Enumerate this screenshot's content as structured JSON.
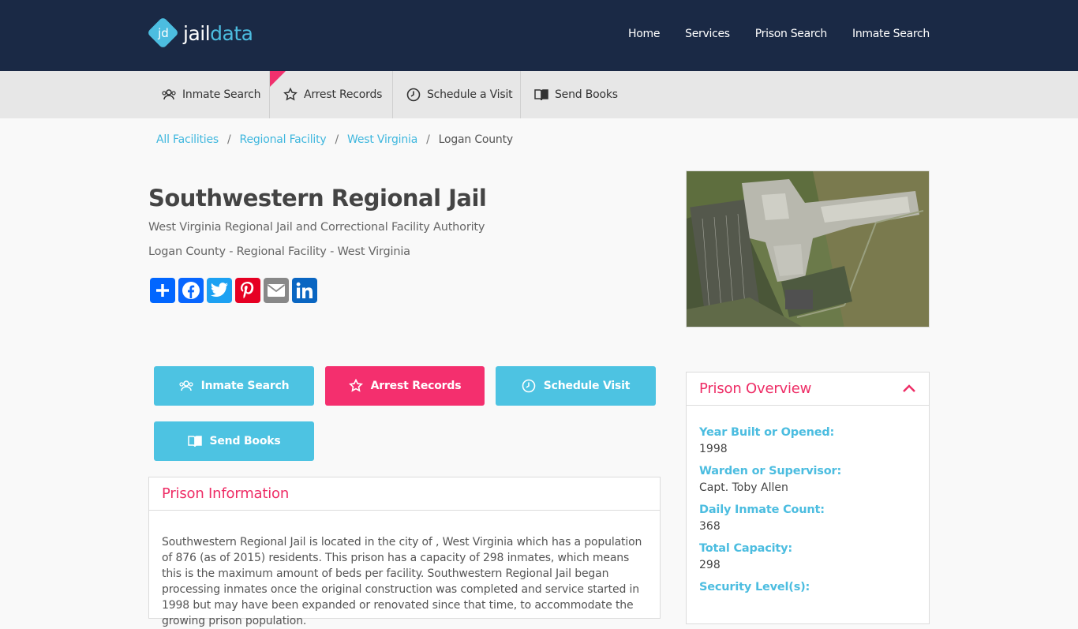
{
  "header": {
    "logo_badge": "jd",
    "logo_text_1": "jail",
    "logo_text_2": "data",
    "nav": [
      "Home",
      "Services",
      "Prison Search",
      "Inmate Search"
    ]
  },
  "subnav": {
    "items": [
      "Inmate Search",
      "Arrest Records",
      "Schedule a Visit",
      "Send Books"
    ]
  },
  "breadcrumb": {
    "items": [
      "All Facilities",
      "Regional Facility",
      "West Virginia"
    ],
    "current": "Logan County",
    "divider": "/"
  },
  "facility": {
    "title": "Southwestern Regional Jail",
    "authority": "West Virginia Regional Jail and Correctional Facility Authority",
    "location_line": "Logan County - Regional Facility - West Virginia"
  },
  "share_icons": [
    "share-plus-icon",
    "facebook-icon",
    "twitter-icon",
    "pinterest-icon",
    "email-icon",
    "linkedin-icon"
  ],
  "actions": {
    "inmate_search": "Inmate Search",
    "arrest_records": "Arrest Records",
    "schedule_visit": "Schedule Visit",
    "send_books": "Send Books"
  },
  "prison_info": {
    "heading": "Prison Information",
    "text": "Southwestern Regional Jail is located in the city of , West Virginia which has a population of 876 (as of 2015) residents. This prison has a capacity of 298 inmates, which means this is the maximum amount of beds per facility. Southwestern Regional Jail began processing inmates once the original construction was completed and service started in 1998 but may have been expanded or renovated since that time, to accommodate the growing prison population."
  },
  "overview": {
    "heading": "Prison Overview",
    "fields": [
      {
        "label": "Year Built or Opened:",
        "value": "1998"
      },
      {
        "label": "Warden or Supervisor:",
        "value": "Capt. Toby Allen"
      },
      {
        "label": "Daily Inmate Count:",
        "value": "368"
      },
      {
        "label": "Total Capacity:",
        "value": "298"
      },
      {
        "label": "Security Level(s):",
        "value": ""
      }
    ]
  },
  "colors": {
    "header_bg": "#1a2945",
    "accent_cyan": "#4dc3e2",
    "accent_pink": "#f42f6e"
  }
}
